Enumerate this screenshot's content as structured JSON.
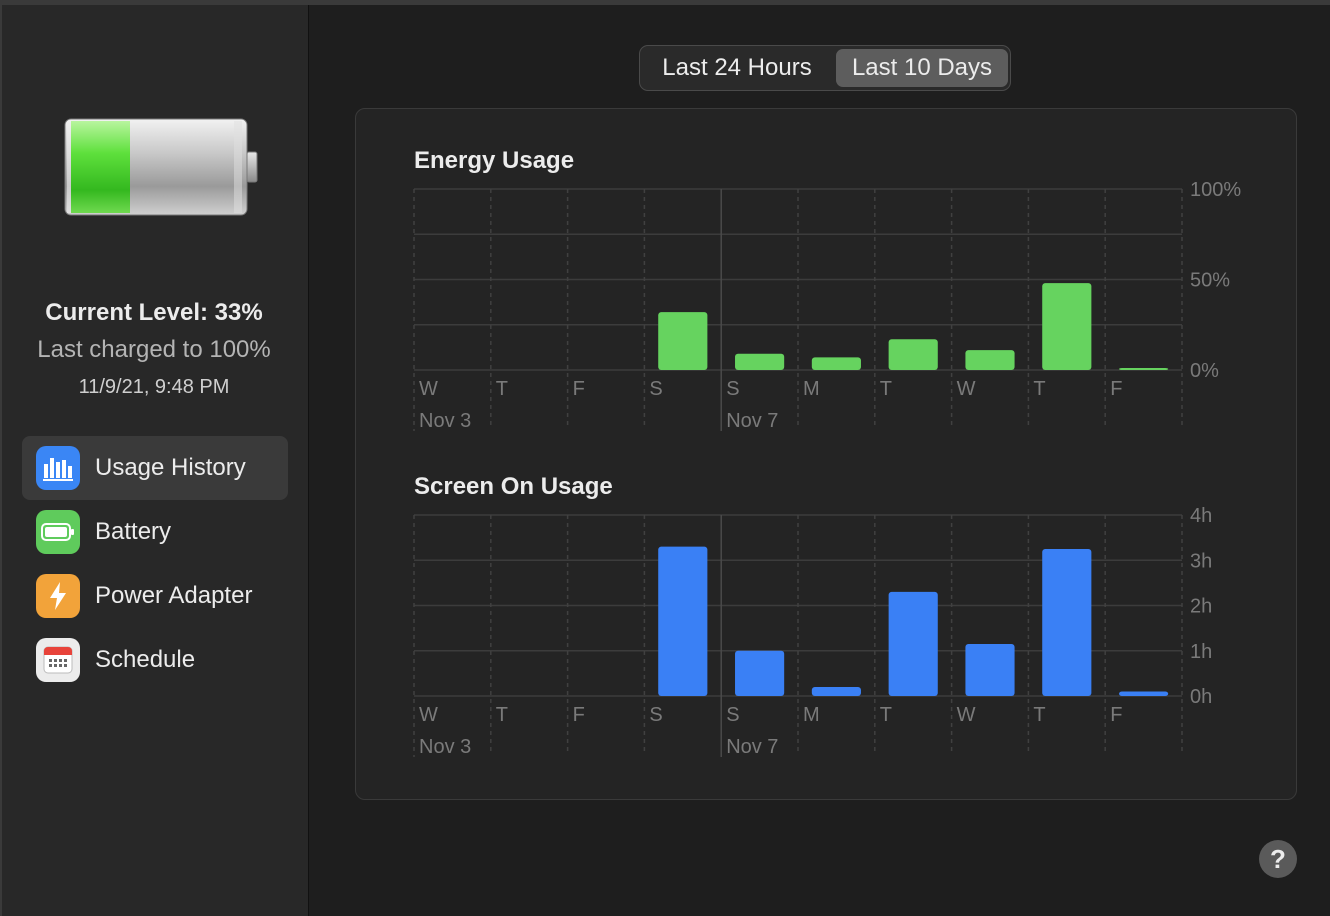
{
  "sidebar": {
    "current_level": "Current Level: 33%",
    "last_charged": "Last charged to 100%",
    "charged_time": "11/9/21, 9:48 PM",
    "items": [
      {
        "label": "Usage History",
        "icon": "bar-chart-icon",
        "color": "#3a86f5",
        "active": true
      },
      {
        "label": "Battery",
        "icon": "battery-icon",
        "color": "#5fcb5c",
        "active": false
      },
      {
        "label": "Power Adapter",
        "icon": "lightning-bolt-icon",
        "color": "#f2a33a",
        "active": false
      },
      {
        "label": "Schedule",
        "icon": "calendar-icon",
        "color": "#ececec",
        "active": false
      }
    ]
  },
  "segmented": {
    "options": [
      "Last 24 Hours",
      "Last 10 Days"
    ],
    "selected": "Last 10 Days"
  },
  "colors": {
    "energy": "#66d35f",
    "screen": "#3a80f5",
    "battery_fill": "#56d43a"
  },
  "battery_level": 0.33,
  "chart_data": [
    {
      "type": "bar",
      "title": "Energy Usage",
      "categories": [
        "W",
        "T",
        "F",
        "S",
        "S",
        "M",
        "T",
        "W",
        "T",
        "F"
      ],
      "date_labels": [
        {
          "index": 0,
          "text": "Nov 3"
        },
        {
          "index": 4,
          "text": "Nov 7"
        }
      ],
      "values": [
        0,
        0,
        0,
        32,
        9,
        7,
        17,
        11,
        48,
        1
      ],
      "ylim": [
        0,
        100
      ],
      "y_ticks": [
        {
          "value": 100,
          "label": "100%"
        },
        {
          "value": 50,
          "label": "50%"
        },
        {
          "value": 0,
          "label": "0%"
        }
      ],
      "grid_values": [
        0,
        25,
        50,
        75,
        100
      ],
      "grid": true
    },
    {
      "type": "bar",
      "title": "Screen On Usage",
      "categories": [
        "W",
        "T",
        "F",
        "S",
        "S",
        "M",
        "T",
        "W",
        "T",
        "F"
      ],
      "date_labels": [
        {
          "index": 0,
          "text": "Nov 3"
        },
        {
          "index": 4,
          "text": "Nov 7"
        }
      ],
      "values": [
        0,
        0,
        0,
        3.3,
        1.0,
        0.2,
        2.3,
        1.15,
        3.25,
        0.1
      ],
      "ylim": [
        0,
        4
      ],
      "y_ticks": [
        {
          "value": 4,
          "label": "4h"
        },
        {
          "value": 3,
          "label": "3h"
        },
        {
          "value": 2,
          "label": "2h"
        },
        {
          "value": 1,
          "label": "1h"
        },
        {
          "value": 0,
          "label": "0h"
        }
      ],
      "grid_values": [
        0,
        1,
        2,
        3,
        4
      ],
      "grid": true
    }
  ]
}
